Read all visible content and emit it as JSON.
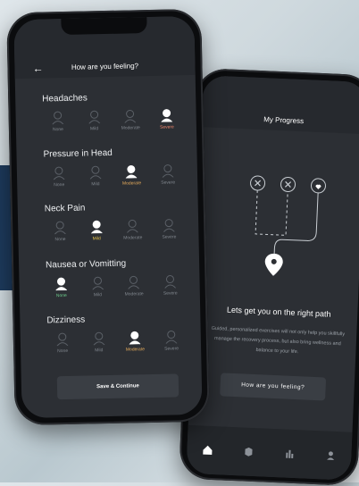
{
  "feeling_screen": {
    "title": "How are you feeling?",
    "back_icon": "←",
    "continue_label": "Save & Continue",
    "levels": [
      "None",
      "Mild",
      "Moderate",
      "Severe"
    ],
    "symptoms": [
      {
        "name": "Headaches",
        "selected": "Severe",
        "selected_color": "#e8836b"
      },
      {
        "name": "Pressure in Head",
        "selected": "Moderate",
        "selected_color": "#e0a85a"
      },
      {
        "name": "Neck Pain",
        "selected": "Mild",
        "selected_color": "#e3c24f"
      },
      {
        "name": "Nausea or Vomitting",
        "selected": "None",
        "selected_color": "#6bc98a"
      },
      {
        "name": "Dizziness",
        "selected": "Moderate",
        "selected_color": "#e0a85a"
      }
    ]
  },
  "progress_screen": {
    "title": "My Progress",
    "heading": "Lets get you on the right path",
    "description": "Guided, personalized exercises will not only help you skillfully manage the recovery process, but also bring wellness and balance to your life.",
    "button_label": "How are you feeling?",
    "nav_icons": [
      "home-icon",
      "box-icon",
      "chart-icon",
      "profile-icon"
    ]
  },
  "colors": {
    "screen": "#2c2f34",
    "header": "#26292e",
    "button": "#3a3e44"
  }
}
